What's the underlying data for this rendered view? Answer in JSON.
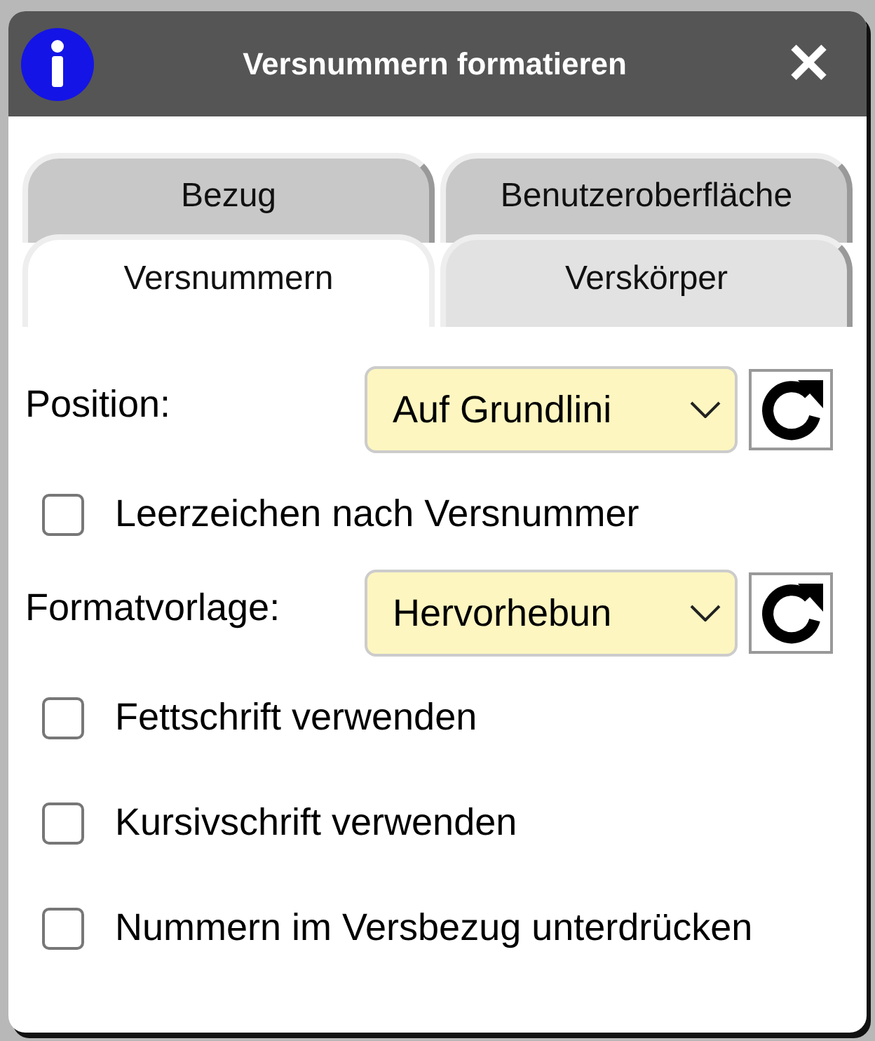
{
  "window": {
    "title": "Versnummern formatieren",
    "close": "✕"
  },
  "tab_rows": [
    [
      {
        "label": "Bezug",
        "selected": false
      },
      {
        "label": "Benutzeroberfläche",
        "selected": false
      }
    ],
    [
      {
        "label": "Versnummern",
        "selected": true
      },
      {
        "label": "Verskörper",
        "selected": false
      }
    ]
  ],
  "fields": [
    {
      "kind": "select",
      "label": "Position:",
      "value": "Auf Grundlini"
    },
    {
      "kind": "checkbox",
      "label": "Leerzeichen nach Versnummer",
      "checked": false
    },
    {
      "kind": "select",
      "label": "Formatvorlage:",
      "value": "Hervorhebun"
    },
    {
      "kind": "checkbox",
      "label": "Fettschrift verwenden",
      "checked": false
    },
    {
      "kind": "checkbox",
      "label": "Kursivschrift verwenden",
      "checked": false
    },
    {
      "kind": "checkbox",
      "label": "Nummern im Versbezug unterdrücken",
      "checked": false
    }
  ]
}
